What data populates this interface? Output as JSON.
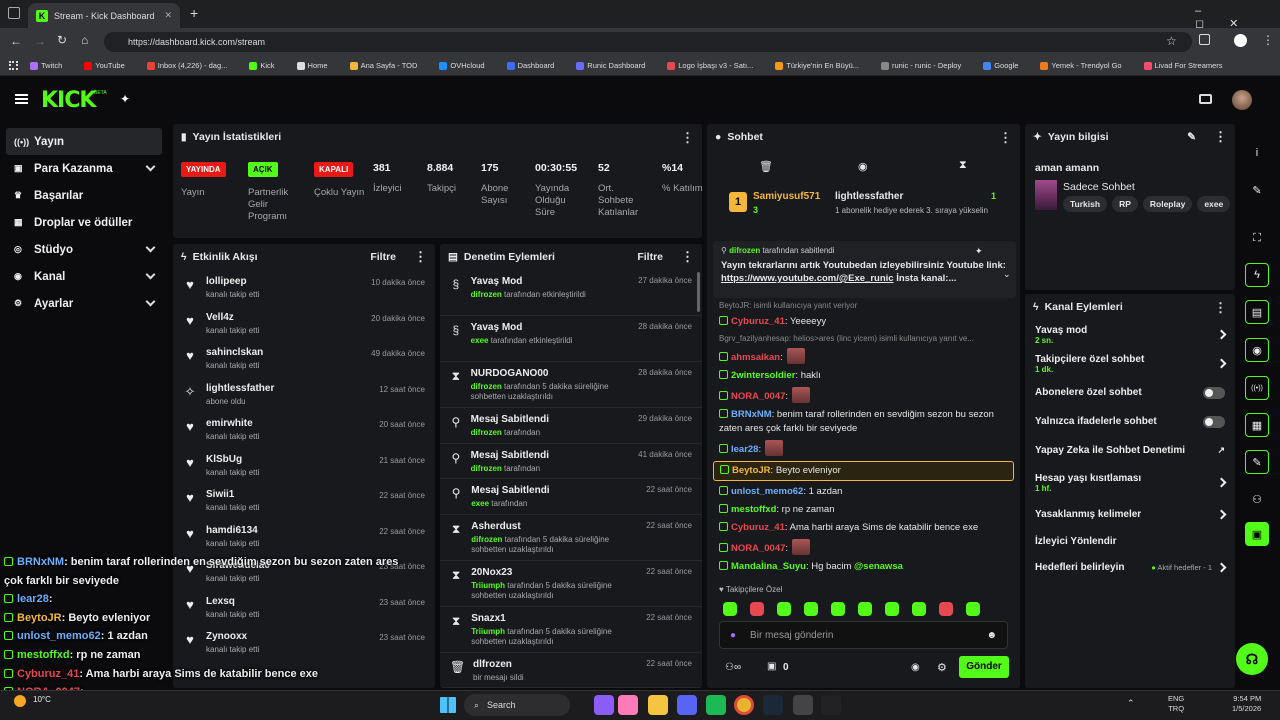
{
  "browser": {
    "tab_title": "Stream - Kick Dashboard",
    "url": "https://dashboard.kick.com/stream",
    "bookmarks": [
      "Twitch",
      "YouTube",
      "Inbox (4,226) - dag...",
      "Kick",
      "Home",
      "Ana Sayfa - TOD",
      "OVHcloud",
      "Dashboard",
      "Runic Dashboard",
      "Logo İşbaşı v3 - Satı...",
      "Türkiye'nin En Büyü...",
      "runic - runic - Deploy",
      "Google",
      "Yemek - Trendyol Go",
      "Livad For Streamers"
    ]
  },
  "brand": {
    "logo": "KICK",
    "beta": "BETA"
  },
  "sidebar": {
    "items": [
      {
        "label": "Yayın",
        "icon": "broadcast-icon"
      },
      {
        "label": "Para Kazanma",
        "icon": "money-icon"
      },
      {
        "label": "Başarılar",
        "icon": "trophy-icon"
      },
      {
        "label": "Droplar ve ödüller",
        "icon": "gift-icon"
      },
      {
        "label": "Stüdyo",
        "icon": "studio-icon"
      },
      {
        "label": "Kanal",
        "icon": "channel-icon"
      },
      {
        "label": "Ayarlar",
        "icon": "settings-icon"
      }
    ]
  },
  "stats": {
    "title": "Yayın İstatistikleri",
    "badges": [
      {
        "badge": "YAYINDA",
        "label": "Yayın",
        "color": "#e91916"
      },
      {
        "badge": "AÇIK",
        "label": "Partnerlik Gelir Programı",
        "color": "#53fc18"
      },
      {
        "badge": "KAPALI",
        "label": "Çoklu Yayın",
        "color": "#e91916"
      }
    ],
    "items": [
      {
        "value": "381",
        "label": "İzleyici"
      },
      {
        "value": "8.884",
        "label": "Takipçi"
      },
      {
        "value": "175",
        "label": "Abone Sayısı"
      },
      {
        "value": "00:30:55",
        "label": "Yayında Olduğu Süre"
      },
      {
        "value": "52",
        "label": "Ort. Sohbete Katılanlar"
      },
      {
        "value": "%14",
        "label": "% Katılım"
      }
    ]
  },
  "activity": {
    "title": "Etkinlik Akışı",
    "filter": "Filtre",
    "events": [
      {
        "name": "lollipeep",
        "sub": "kanalı takip etti",
        "time": "10 dakika önce",
        "icon": "heart-icon"
      },
      {
        "name": "Vell4z",
        "sub": "kanalı takip etti",
        "time": "20 dakika önce",
        "icon": "heart-icon"
      },
      {
        "name": "sahinclskan",
        "sub": "kanalı takip etti",
        "time": "49 dakika önce",
        "icon": "heart-icon"
      },
      {
        "name": "lightlessfather",
        "sub": "abone oldu",
        "time": "12 saat önce",
        "icon": "star-icon"
      },
      {
        "name": "emirwhite",
        "sub": "kanalı takip etti",
        "time": "20 saat önce",
        "icon": "heart-icon"
      },
      {
        "name": "KlSbUg",
        "sub": "kanalı takip etti",
        "time": "21 saat önce",
        "icon": "heart-icon"
      },
      {
        "name": "Siwii1",
        "sub": "kanalı takip etti",
        "time": "22 saat önce",
        "icon": "heart-icon"
      },
      {
        "name": "hamdi6134",
        "sub": "kanalı takip etti",
        "time": "22 saat önce",
        "icon": "heart-icon"
      },
      {
        "name": "Sirawendela0",
        "sub": "kanalı takip etti",
        "time": "23 saat önce",
        "icon": "heart-icon"
      },
      {
        "name": "Lexsq",
        "sub": "kanalı takip etti",
        "time": "23 saat önce",
        "icon": "heart-icon"
      },
      {
        "name": "Zynooxx",
        "sub": "kanalı takip etti",
        "time": "23 saat önce",
        "icon": "heart-icon"
      }
    ]
  },
  "moderation": {
    "title": "Denetim Eylemleri",
    "filter": "Filtre",
    "events": [
      {
        "title": "Yavaş Mod",
        "user": "difrozen",
        "sub": "tarafından etkinleştirildi",
        "time": "27 dakika önce",
        "icon": "snail-icon"
      },
      {
        "title": "Yavaş Mod",
        "user": "exee",
        "sub": "tarafından etkinleştirildi",
        "time": "28 dakika önce",
        "icon": "snail-icon"
      },
      {
        "title": "NURDOGANO00",
        "user": "difrozen",
        "sub": "tarafından 5 dakika süreliğine sohbetten uzaklaştırıldı",
        "time": "28 dakika önce",
        "icon": "hourglass-icon"
      },
      {
        "title": "Mesaj Sabitlendi",
        "user": "difrozen",
        "sub": "tarafından",
        "time": "29 dakika önce",
        "icon": "pin-icon"
      },
      {
        "title": "Mesaj Sabitlendi",
        "user": "difrozen",
        "sub": "tarafından",
        "time": "41 dakika önce",
        "icon": "pin-icon"
      },
      {
        "title": "Mesaj Sabitlendi",
        "user": "exee",
        "sub": "tarafından",
        "time": "22 saat önce",
        "icon": "pin-icon"
      },
      {
        "title": "Asherdust",
        "user": "difrozen",
        "sub": "tarafından 5 dakika süreliğine sohbetten uzaklaştırıldı",
        "time": "22 saat önce",
        "icon": "hourglass-icon"
      },
      {
        "title": "20Nox23",
        "user": "Triiumph",
        "sub": "tarafından 5 dakika süreliğine sohbetten uzaklaştırıldı",
        "time": "22 saat önce",
        "icon": "hourglass-icon"
      },
      {
        "title": "Snazx1",
        "user": "Triiumph",
        "sub": "tarafından 5 dakika süreliğine sohbetten uzaklaştırıldı",
        "time": "22 saat önce",
        "icon": "hourglass-icon"
      },
      {
        "title": "dlfrozen",
        "user": "",
        "sub": "bir mesajı sildi",
        "time": "22 saat önce",
        "icon": "trash-icon"
      }
    ]
  },
  "chat": {
    "title": "Sohbet",
    "leader_rank": "1",
    "leader_name": "Samiyusuf571",
    "leader_count": "3",
    "gift_user": "lightlessfather",
    "gift_count": "1",
    "gift_text": "1 abonelik hediye ederek 3. sıraya yükselin",
    "pinned_by": "difrozen",
    "pinned_suffix": "tarafından sabitlendi",
    "pinned_text": "Yayın tekrarlarını artık Youtubedan izleyebilirsiniz Youtube link:",
    "pinned_link": "https://www.youtube.com/@Exe_runic",
    "pinned_tail": "İnsta kanal:...",
    "messages": [
      {
        "reply": "BeytoJR: isimli kullanıcıya yanıt veriyor"
      },
      {
        "user": "Cyburuz_41",
        "color": "#e8484f",
        "text": ": Yeeeeyy"
      },
      {
        "reply": "Bgrv_fazilyanhesap: helios>ares (linc yicem) isimli kullanıcıya yanıt ve..."
      },
      {
        "user": "ahmsaikan",
        "color": "#e8484f",
        "text": ":"
      },
      {
        "user": "2wintersoldier",
        "color": "#53fc18",
        "text": ": haklı"
      },
      {
        "user": "NORA_0047",
        "color": "#e8484f",
        "text": ":"
      },
      {
        "user": "BRNxNM",
        "color": "#6ab0ff",
        "text": ": benim taraf rollerinden en sevdiğim sezon bu sezon zaten ares çok farklı bir seviyede"
      },
      {
        "user": "lear28",
        "color": "#6ab0ff",
        "text": ":"
      },
      {
        "user": "BeytoJR",
        "color": "#f5b73b",
        "text": ": Beyto evleniyor",
        "highlight": true
      },
      {
        "user": "unlost_memo62",
        "color": "#6ab0ff",
        "text": ": 1 azdan"
      },
      {
        "user": "mestoffxd",
        "color": "#53fc18",
        "text": ": rp ne zaman"
      },
      {
        "user": "Cyburuz_41",
        "color": "#e8484f",
        "text": ": Ama harbi araya Sims de katabilir bence exe"
      },
      {
        "user": "NORA_0047",
        "color": "#e8484f",
        "text": ":"
      },
      {
        "user": "Mandal̇ina_Suyu",
        "color": "#53fc18",
        "text": ": Hg bacim",
        "mention": "@senawsa"
      }
    ],
    "followers_only": "Takipçilere Özel",
    "input_placeholder": "Bir mesaj gönderin",
    "points": "0",
    "send": "Gönder"
  },
  "stream_info": {
    "title": "Yayın bilgisi",
    "stream_title": "aman amann",
    "category": "Sadece Sohbet",
    "tags": [
      "Turkish",
      "RP",
      "Roleplay",
      "exee"
    ]
  },
  "channel_actions": {
    "title": "Kanal Eylemleri",
    "items": [
      {
        "label": "Yavaş mod",
        "sub": "2 sn.",
        "control": "arrow"
      },
      {
        "label": "Takipçilere özel sohbet",
        "sub": "1 dk.",
        "control": "arrow"
      },
      {
        "label": "Abonelere özel sohbet",
        "sub": "",
        "control": "toggle"
      },
      {
        "label": "Yalnızca ifadelerle sohbet",
        "sub": "",
        "control": "toggle"
      },
      {
        "label": "Yapay Zeka ile Sohbet Denetimi",
        "sub": "",
        "control": "external"
      },
      {
        "label": "Hesap yaşı kısıtlaması",
        "sub": "1 hf.",
        "control": "arrow"
      },
      {
        "label": "Yasaklanmış kelimeler",
        "sub": "",
        "control": "arrow"
      },
      {
        "label": "İzleyici Yönlendir",
        "sub": "",
        "control": "none"
      },
      {
        "label": "Hedefleri belirleyin",
        "sub": "",
        "control": "arrow",
        "status": "Aktif hedefler - 1"
      }
    ]
  },
  "overlay": {
    "lines": [
      {
        "user": "BRNxNM",
        "color": "#6ab0ff",
        "text": ": benim taraf rollerinden en sevdiğim sezon bu sezon zaten ares"
      },
      {
        "user": "",
        "color": "#eee",
        "text": "çok farklı bir seviyede"
      },
      {
        "user": "lear28",
        "color": "#6ab0ff",
        "text": ":"
      },
      {
        "user": "BeytoJR",
        "color": "#f5b73b",
        "text": ": Beyto evleniyor"
      },
      {
        "user": "unlost_memo62",
        "color": "#6ab0ff",
        "text": ": 1 azdan"
      },
      {
        "user": "mestoffxd",
        "color": "#53fc18",
        "text": ": rp ne zaman"
      },
      {
        "user": "Cyburuz_41",
        "color": "#e8484f",
        "text": ": Ama harbi araya Sims de katabilir bence exe"
      },
      {
        "user": "NORA_0047",
        "color": "#e8484f",
        "text": ":"
      },
      {
        "user": "",
        "color": "#eee",
        "text": "ndal̇ina_Suyu: Hg bacim @senawsa"
      }
    ]
  },
  "taskbar": {
    "search": "Search",
    "weather": "10°C",
    "lang1": "ENG",
    "lang2": "TRQ",
    "time": "9:54 PM",
    "date": "1/5/2026"
  }
}
